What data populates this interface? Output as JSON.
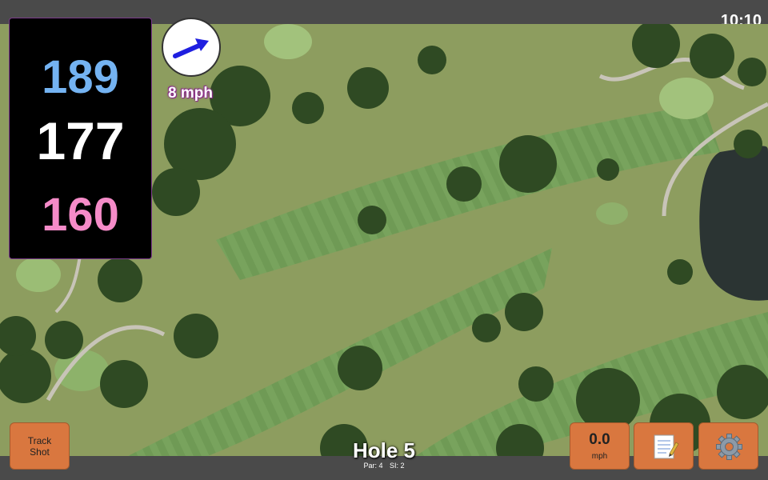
{
  "status_bar": {
    "time": "10:10"
  },
  "distances": {
    "back": "189",
    "middle": "177",
    "front": "160"
  },
  "wind": {
    "label": "8 mph",
    "direction_icon": "wind-arrow-icon"
  },
  "buttons": {
    "track_shot": "Track\nShot",
    "wind_speed_value": "0.0",
    "wind_speed_unit": "mph",
    "notes_icon": "notepad-icon",
    "settings_icon": "gear-icon"
  },
  "hole": {
    "title": "Hole 5",
    "par": "Par: 4",
    "si": "SI: 2"
  },
  "colors": {
    "button": "#d9773f",
    "back_distance": "#74b3f2",
    "front_distance": "#f58bc8",
    "panel": "#000000"
  }
}
